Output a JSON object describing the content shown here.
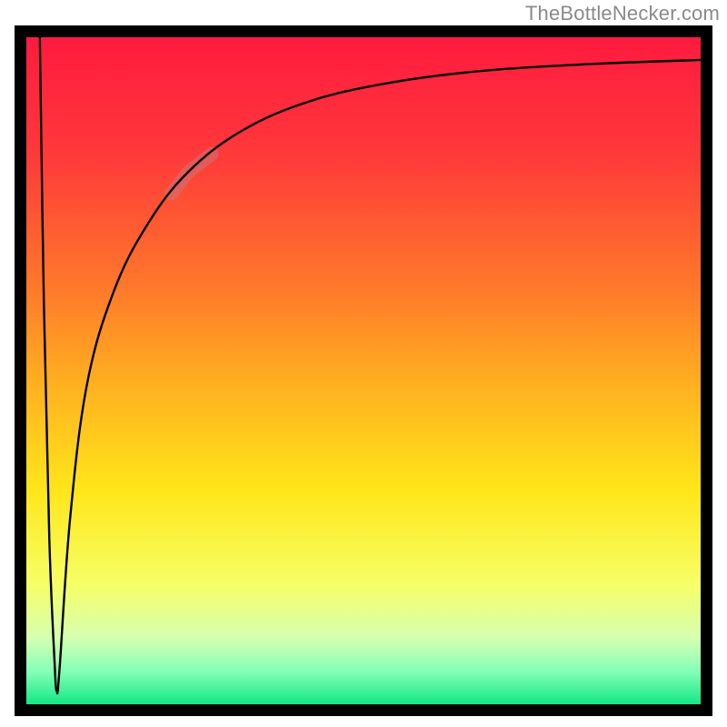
{
  "watermark": "TheBottleNecker.com",
  "colors": {
    "gradient": [
      {
        "offset": 0.0,
        "hex": "#ff1a3f"
      },
      {
        "offset": 0.18,
        "hex": "#ff3a3a"
      },
      {
        "offset": 0.38,
        "hex": "#ff7a2a"
      },
      {
        "offset": 0.52,
        "hex": "#ffb020"
      },
      {
        "offset": 0.68,
        "hex": "#ffe61a"
      },
      {
        "offset": 0.82,
        "hex": "#f6ff66"
      },
      {
        "offset": 0.9,
        "hex": "#d6ffb0"
      },
      {
        "offset": 0.95,
        "hex": "#86ffb8"
      },
      {
        "offset": 1.0,
        "hex": "#12e884"
      }
    ],
    "border": "#000000",
    "curve": "#000000",
    "highlight": "rgba(255,255,255,0.38)",
    "highlight_stroke": "rgba(200,120,120,0.6)"
  },
  "layout": {
    "outer_x": 16,
    "outer_y": 28,
    "outer_w": 768,
    "outer_h": 760,
    "border_px": 13,
    "inner_x": 29,
    "inner_y": 41,
    "inner_w": 742,
    "inner_h": 734
  },
  "chart_data": {
    "type": "line",
    "title": "",
    "xlabel": "",
    "ylabel": "",
    "x_range": [
      0,
      100
    ],
    "y_range": [
      0,
      100
    ],
    "note": "No axis ticks or legend are rendered in the source image; values are unlabeled. x/y are in percent of inner plot area (0 = left/bottom, 100 = right/top).",
    "series": [
      {
        "name": "curve",
        "points": [
          {
            "x": 2.0,
            "y": 100.0
          },
          {
            "x": 2.6,
            "y": 60.0
          },
          {
            "x": 3.4,
            "y": 25.0
          },
          {
            "x": 4.2,
            "y": 6.0
          },
          {
            "x": 4.5,
            "y": 2.0
          },
          {
            "x": 4.9,
            "y": 5.0
          },
          {
            "x": 6.5,
            "y": 28.0
          },
          {
            "x": 9.0,
            "y": 48.0
          },
          {
            "x": 13.0,
            "y": 62.0
          },
          {
            "x": 18.0,
            "y": 72.0
          },
          {
            "x": 24.0,
            "y": 79.8
          },
          {
            "x": 32.0,
            "y": 86.0
          },
          {
            "x": 42.0,
            "y": 90.4
          },
          {
            "x": 54.0,
            "y": 93.2
          },
          {
            "x": 68.0,
            "y": 95.0
          },
          {
            "x": 84.0,
            "y": 96.0
          },
          {
            "x": 100.0,
            "y": 96.6
          }
        ]
      }
    ],
    "highlight_segment": {
      "series": "curve",
      "x_start": 21.5,
      "x_end": 27.5
    }
  }
}
